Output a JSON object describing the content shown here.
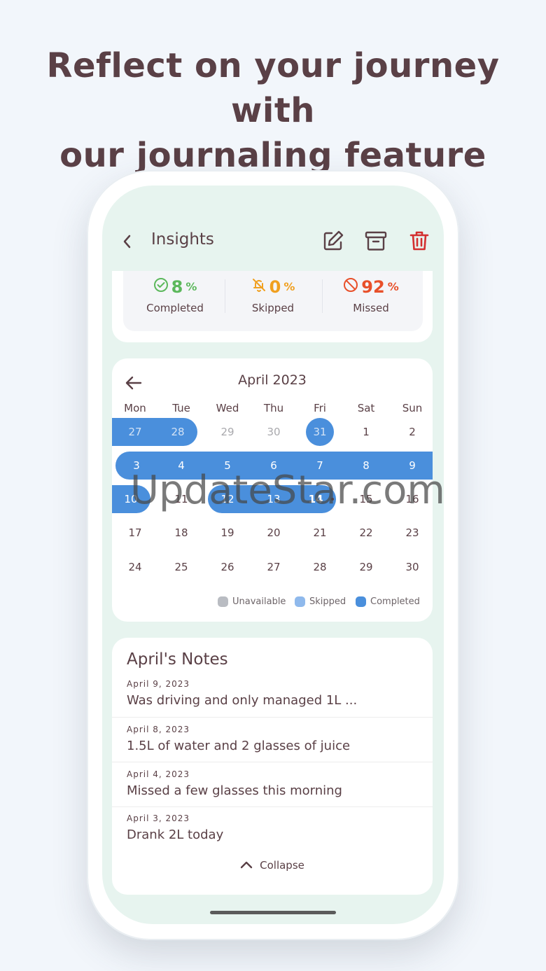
{
  "headline": {
    "line1": "Reflect on your journey with",
    "line2": "our journaling feature"
  },
  "header": {
    "title": "Insights",
    "icons": [
      "back-chevron-icon",
      "edit-icon",
      "archive-icon",
      "trash-icon"
    ]
  },
  "stats": [
    {
      "value": "8",
      "unit": "%",
      "label": "Completed",
      "color": "#5cb85c",
      "icon": "check-circle-icon"
    },
    {
      "value": "0",
      "unit": "%",
      "label": "Skipped",
      "color": "#f0a020",
      "icon": "bell-off-icon"
    },
    {
      "value": "92",
      "unit": "%",
      "label": "Missed",
      "color": "#e8502a",
      "icon": "ban-icon"
    }
  ],
  "calendar": {
    "month": "April 2023",
    "weekdays": [
      "Mon",
      "Tue",
      "Wed",
      "Thu",
      "Fri",
      "Sat",
      "Sun"
    ],
    "weeks": [
      [
        "27",
        "28",
        "29",
        "30",
        "31",
        "1",
        "2"
      ],
      [
        "3",
        "4",
        "5",
        "6",
        "7",
        "8",
        "9"
      ],
      [
        "10",
        "11",
        "12",
        "13",
        "14",
        "15",
        "16"
      ],
      [
        "17",
        "18",
        "19",
        "20",
        "21",
        "22",
        "23"
      ],
      [
        "24",
        "25",
        "26",
        "27",
        "28",
        "29",
        "30"
      ]
    ],
    "legend": [
      {
        "label": "Unavailable",
        "color": "#b9bcc2"
      },
      {
        "label": "Skipped",
        "color": "#8fb9ec"
      },
      {
        "label": "Completed",
        "color": "#4a8fdc"
      }
    ]
  },
  "notes": {
    "title": "April's Notes",
    "items": [
      {
        "date": "April 9, 2023",
        "text": "Was driving and only managed 1L ..."
      },
      {
        "date": "April 8, 2023",
        "text": "1.5L of water and 2 glasses of juice"
      },
      {
        "date": "April 4, 2023",
        "text": "Missed a few glasses this morning"
      },
      {
        "date": "April 3, 2023",
        "text": "Drank 2L today"
      }
    ],
    "collapse_label": "Collapse"
  },
  "watermark": "UpdateStar.com"
}
